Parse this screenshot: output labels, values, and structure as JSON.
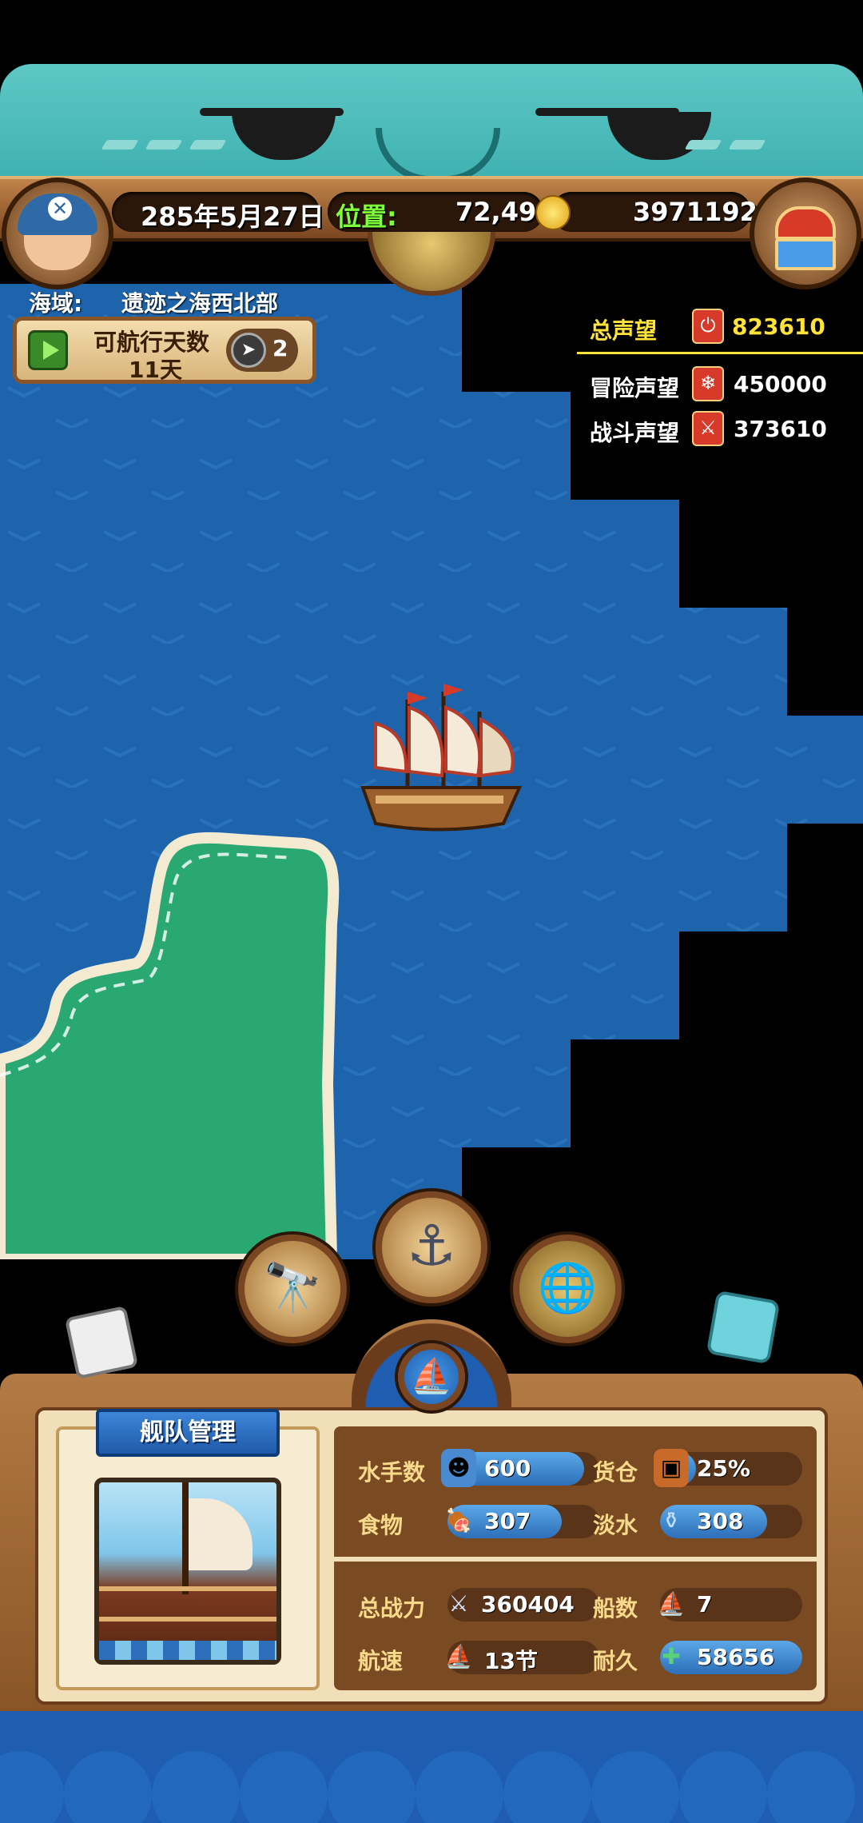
{
  "topbar": {
    "date": "285年5月27日",
    "position_label": "位置:",
    "position_value": "72,49",
    "gold": "3971192"
  },
  "region": {
    "label": "海域:",
    "name": "遗迹之海西北部"
  },
  "sailing": {
    "title": "可航行天数",
    "days": "11天",
    "compass_count": "2"
  },
  "reputation": {
    "total_label": "总声望",
    "total_value": "823610",
    "adventure_label": "冒险声望",
    "adventure_value": "450000",
    "battle_label": "战斗声望",
    "battle_value": "373610"
  },
  "fleet": {
    "title": "舰队管理",
    "sailors_label": "水手数",
    "sailors_value": "600",
    "sailors_fill": 0.9,
    "cargo_label": "货仓",
    "cargo_value": "25%",
    "cargo_fill": 0.25,
    "food_label": "食物",
    "food_value": "307",
    "food_fill": 0.75,
    "water_label": "淡水",
    "water_value": "308",
    "water_fill": 0.75,
    "power_label": "总战力",
    "power_value": "360404",
    "ships_label": "船数",
    "ships_value": "7",
    "speed_label": "航速",
    "speed_value": "13节",
    "durability_label": "耐久",
    "durability_value": "58656",
    "durability_fill": 1.0
  },
  "colors": {
    "sea": "#1d64ad",
    "land": "#2aa872",
    "gold_text": "#ffe23a",
    "green_text": "#7dff3a"
  }
}
